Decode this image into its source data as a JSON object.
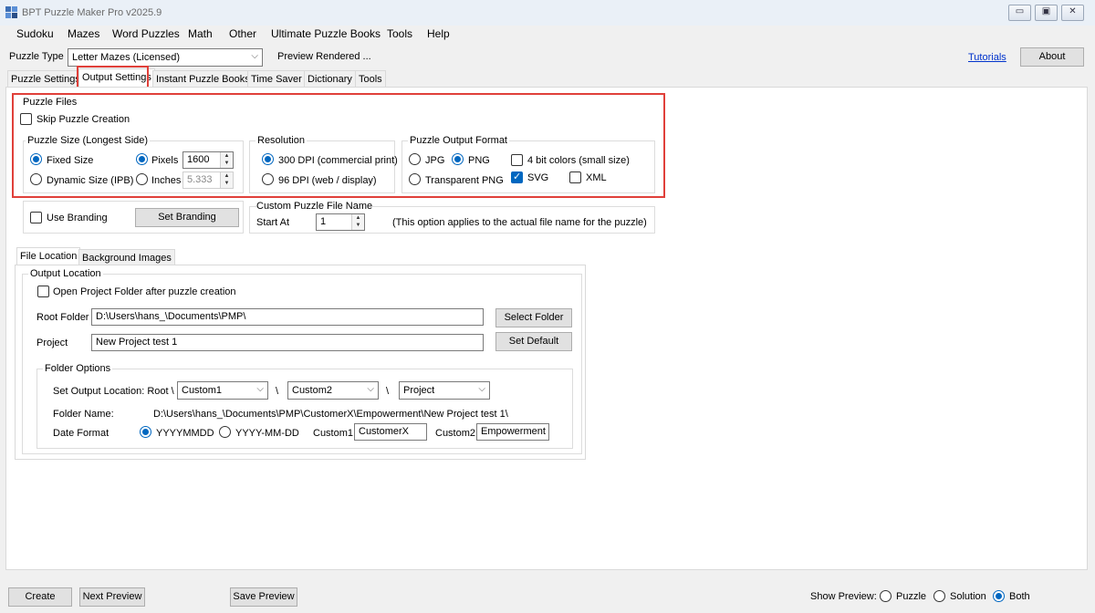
{
  "app": {
    "title": "BPT Puzzle Maker Pro v2025.9",
    "window_buttons": [
      "▭",
      "▣",
      "✕"
    ]
  },
  "menu": [
    "Sudoku",
    "Mazes",
    "Word Puzzles",
    "Math",
    "Other",
    "Ultimate Puzzle Books",
    "Tools",
    "Help"
  ],
  "top": {
    "puzzle_type_label": "Puzzle Type",
    "puzzle_type_value": "Letter Mazes (Licensed)",
    "preview_status": "Preview Rendered ...",
    "tutorials": "Tutorials",
    "about": "About"
  },
  "tabs": [
    "Puzzle Settings",
    "Output Settings",
    "Instant Puzzle Books",
    "Time Saver",
    "Dictionary",
    "Tools"
  ],
  "puzzle_files": {
    "title": "Puzzle Files",
    "skip_creation": "Skip Puzzle Creation",
    "size_group": {
      "title": "Puzzle Size (Longest Side)",
      "fixed": "Fixed Size",
      "dynamic": "Dynamic Size (IPB)",
      "pixels": "Pixels",
      "pixels_value": "1600",
      "inches": "Inches",
      "inches_value": "5.333"
    },
    "resolution": {
      "title": "Resolution",
      "dpi300": "300 DPI (commercial print)",
      "dpi96": "96  DPI (web / display)"
    },
    "format": {
      "title": "Puzzle Output Format",
      "jpg": "JPG",
      "png": "PNG",
      "transparent_png": "Transparent PNG",
      "bit4": "4 bit colors (small size)",
      "svg": "SVG",
      "xml": "XML"
    }
  },
  "branding": {
    "use": "Use Branding",
    "set": "Set Branding"
  },
  "custom_name": {
    "title": "Custom Puzzle File Name",
    "start_at": "Start At",
    "start_value": "1",
    "note": "(This option applies to the actual file name for the puzzle)"
  },
  "subtabs": [
    "File Location",
    "Background Images"
  ],
  "output_location": {
    "title": "Output Location",
    "open_folder": "Open Project Folder after puzzle creation",
    "root_folder_label": "Root Folder",
    "root_folder_value": "D:\\Users\\hans_\\Documents\\PMP\\",
    "select_folder": "Select Folder",
    "project_label": "Project",
    "project_value": "New Project test 1",
    "set_default": "Set Default"
  },
  "folder_options": {
    "title": "Folder Options",
    "set_output_label": "Set Output Location: Root \\",
    "combo1": "Custom1",
    "combo2": "Custom2",
    "combo3": "Project",
    "sep": "\\",
    "folder_name_label": "Folder Name:",
    "folder_name_value": "D:\\Users\\hans_\\Documents\\PMP\\CustomerX\\Empowerment\\New Project test 1\\",
    "date_format_label": "Date Format",
    "date1": "YYYYMMDD",
    "date2": "YYYY-MM-DD",
    "custom1_label": "Custom1:",
    "custom1_value": "CustomerX",
    "custom2_label": "Custom2:",
    "custom2_value": "Empowerment"
  },
  "bottom": {
    "create": "Create",
    "next_preview": "Next Preview",
    "save_preview": "Save Preview",
    "show_preview": "Show Preview:",
    "puzzle": "Puzzle",
    "solution": "Solution",
    "both": "Both"
  }
}
